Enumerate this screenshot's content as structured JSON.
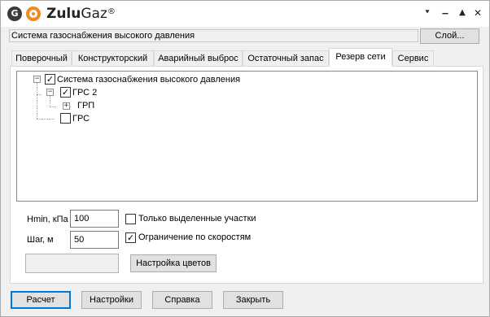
{
  "window": {
    "logo_letter": "G",
    "app_name_part1": "Zulu",
    "app_name_part2": "Gaz",
    "app_name_mark": "®",
    "controls": {
      "menu": "⯆",
      "minimize": "▁",
      "maximize": "▲",
      "close": "✕"
    }
  },
  "system_bar": {
    "system_name": "Система газоснабжения высокого давления",
    "layer_button": "Слой..."
  },
  "tabs": [
    {
      "label": "Поверочный"
    },
    {
      "label": "Конструкторский"
    },
    {
      "label": "Аварийный выброс"
    },
    {
      "label": "Остаточный запас"
    },
    {
      "label": "Резерв сети"
    },
    {
      "label": "Сервис"
    }
  ],
  "active_tab": "Резерв сети",
  "tree": {
    "root": {
      "label": "Система газоснабжения высокого давления",
      "checked": true,
      "expander": "−"
    },
    "child1": {
      "label": "ГРС 2",
      "checked": true,
      "expander": "−"
    },
    "grandchild1": {
      "label": "ГРП",
      "expander": "+"
    },
    "child2": {
      "label": "ГРС",
      "checked": false
    }
  },
  "params": {
    "hmin_label": "Hmin, кПа",
    "hmin_value": "100",
    "step_label": "Шаг, м",
    "step_value": "50",
    "only_selected_label": "Только выделенные участки",
    "only_selected_checked": false,
    "speed_limit_label": "Ограничение по скоростям",
    "speed_limit_checked": true,
    "color_settings_button": "Настройка цветов"
  },
  "footer": {
    "calculate": "Расчет",
    "settings": "Настройки",
    "help": "Справка",
    "close": "Закрыть"
  },
  "colors": {
    "accent": "#0078d7",
    "logo_orange": "#ef8a1c",
    "logo_dark": "#3a3a3a"
  }
}
